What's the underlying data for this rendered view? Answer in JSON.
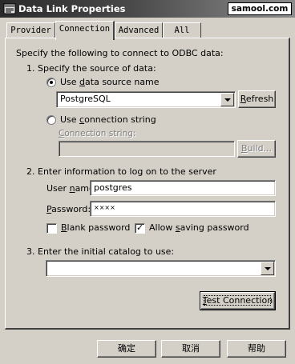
{
  "window": {
    "title": "Data Link Properties",
    "watermark": "samool.com"
  },
  "tabs": [
    {
      "label": "Provider"
    },
    {
      "label": "Connection"
    },
    {
      "label": "Advanced"
    },
    {
      "label": "All"
    }
  ],
  "connection": {
    "intro": "Specify the following to connect to ODBC data:",
    "step1": {
      "label": "1. Specify the source of data:",
      "dsn_option": {
        "pre": "Use ",
        "mnemonic": "d",
        "post": "ata source name",
        "selected": true
      },
      "dsn_value": "PostgreSQL",
      "refresh_button": {
        "mnemonic": "R",
        "rest": "efresh"
      },
      "connstr_option": {
        "pre": "Use ",
        "mnemonic": "c",
        "post": "onnection string",
        "selected": false
      },
      "connstr_label": {
        "mnemonic": "C",
        "rest": "onnection string:"
      },
      "connstr_value": "",
      "build_button": {
        "mnemonic": "B",
        "rest": "uild..."
      }
    },
    "step2": {
      "label": "2. Enter information to log on to the server",
      "username": {
        "pre": "User ",
        "mnemonic": "n",
        "post": "ame:",
        "value": "postgres"
      },
      "password": {
        "mnemonic": "P",
        "post": "assword:",
        "value": "××××"
      },
      "blank_password": {
        "mnemonic": "B",
        "rest": "lank password",
        "checked": false
      },
      "allow_saving": {
        "pre": "Allow ",
        "mnemonic": "s",
        "post": "aving password",
        "checked": true
      }
    },
    "step3": {
      "label": "3. Enter the initial catalog to use:",
      "catalog_value": ""
    },
    "test_button": {
      "mnemonic": "T",
      "rest": "est Connection"
    }
  },
  "footer": {
    "ok": "确定",
    "cancel": "取消",
    "help": "帮助"
  },
  "colors": {
    "face": "#d4d0c8",
    "shadow": "#808080",
    "dark_shadow": "#404040",
    "highlight": "#ffffff"
  },
  "icons": {
    "title_icon": "data-link-icon",
    "radio": "radio-button",
    "checkbox": "checkbox",
    "dropdown": "chevron-down-icon"
  }
}
